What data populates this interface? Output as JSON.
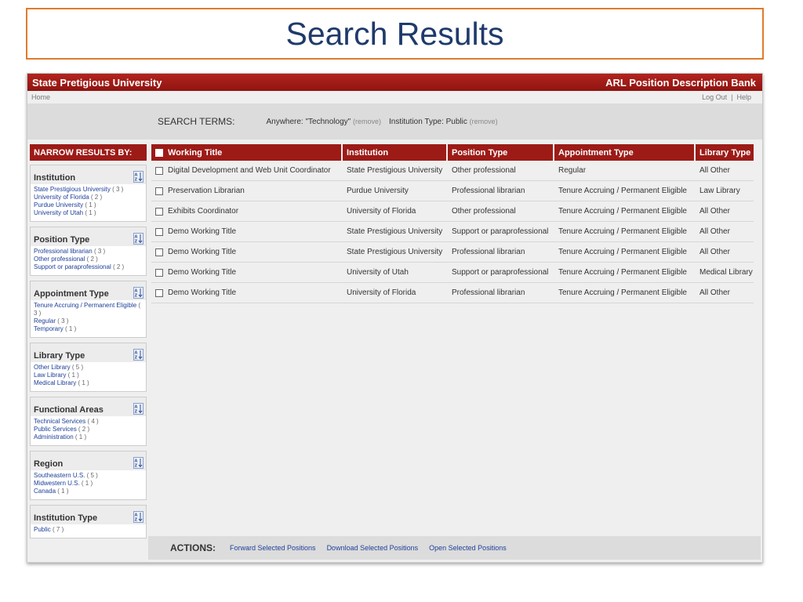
{
  "slide_title": "Search Results",
  "app": {
    "brand": "State Pretigious University",
    "bank_title": "ARL Position Description Bank",
    "nav": {
      "home": "Home",
      "logout": "Log Out",
      "separator": "|",
      "help": "Help"
    }
  },
  "search_terms": {
    "label": "SEARCH TERMS:",
    "terms": [
      {
        "text": "Anywhere: \"Technology\"",
        "remove": "(remove)"
      },
      {
        "text": "Institution Type: Public",
        "remove": "(remove)"
      }
    ]
  },
  "sidebar": {
    "heading": "NARROW RESULTS BY:",
    "facets": [
      {
        "title": "Institution",
        "items": [
          {
            "label": "State Prestigious University",
            "count": "( 3 )"
          },
          {
            "label": "University of Florida",
            "count": "( 2 )"
          },
          {
            "label": "Purdue University",
            "count": "( 1 )"
          },
          {
            "label": "University of Utah",
            "count": "( 1 )"
          }
        ]
      },
      {
        "title": "Position Type",
        "items": [
          {
            "label": "Professional librarian",
            "count": "( 3 )"
          },
          {
            "label": "Other professional",
            "count": "( 2 )"
          },
          {
            "label": "Support or paraprofessional",
            "count": "( 2 )"
          }
        ]
      },
      {
        "title": "Appointment Type",
        "items": [
          {
            "label": "Tenure Accruing / Permanent Eligible",
            "count": "( 3 )"
          },
          {
            "label": "Regular",
            "count": "( 3 )"
          },
          {
            "label": "Temporary",
            "count": "( 1 )"
          }
        ]
      },
      {
        "title": "Library Type",
        "items": [
          {
            "label": "Other Library",
            "count": "( 5 )"
          },
          {
            "label": "Law Library",
            "count": "( 1 )"
          },
          {
            "label": "Medical Library",
            "count": "( 1 )"
          }
        ]
      },
      {
        "title": "Functional Areas",
        "items": [
          {
            "label": "Technical Services",
            "count": "( 4 )"
          },
          {
            "label": "Public Services",
            "count": "( 2 )"
          },
          {
            "label": "Administration",
            "count": "( 1 )"
          }
        ]
      },
      {
        "title": "Region",
        "items": [
          {
            "label": "Southeastern U.S.",
            "count": "( 5 )"
          },
          {
            "label": "Midwestern U.S.",
            "count": "( 1 )"
          },
          {
            "label": "Canada",
            "count": "( 1 )"
          }
        ]
      },
      {
        "title": "Institution Type",
        "items": [
          {
            "label": "Public",
            "count": "( 7 )"
          }
        ]
      }
    ]
  },
  "table": {
    "columns": [
      "Working Title",
      "Institution",
      "Position Type",
      "Appointment Type",
      "Library Type"
    ],
    "rows": [
      [
        "Digital Development and Web Unit Coordinator",
        "State Prestigious University",
        "Other professional",
        "Regular",
        "All Other"
      ],
      [
        "Preservation Librarian",
        "Purdue University",
        "Professional librarian",
        "Tenure Accruing / Permanent Eligible",
        "Law Library"
      ],
      [
        "Exhibits Coordinator",
        "University of Florida",
        "Other professional",
        "Tenure Accruing / Permanent Eligible",
        "All Other"
      ],
      [
        "Demo Working Title",
        "State Prestigious University",
        "Support or paraprofessional",
        "Tenure Accruing / Permanent Eligible",
        "All Other"
      ],
      [
        "Demo Working Title",
        "State Prestigious University",
        "Professional librarian",
        "Tenure Accruing / Permanent Eligible",
        "All Other"
      ],
      [
        "Demo Working Title",
        "University of Utah",
        "Support or paraprofessional",
        "Tenure Accruing / Permanent Eligible",
        "Medical Library"
      ],
      [
        "Demo Working Title",
        "University of Florida",
        "Professional librarian",
        "Tenure Accruing / Permanent Eligible",
        "All Other"
      ]
    ]
  },
  "actions": {
    "label": "ACTIONS:",
    "items": [
      "Forward Selected Positions",
      "Download Selected Positions",
      "Open Selected Positions"
    ]
  },
  "icons": {
    "sort": "sort-az-icon",
    "checkbox": "checkbox-icon"
  },
  "colors": {
    "header_red": "#9c1b17",
    "link_blue": "#1e3f9a",
    "title_border": "#e07b2a",
    "title_text": "#1f3a6b"
  }
}
